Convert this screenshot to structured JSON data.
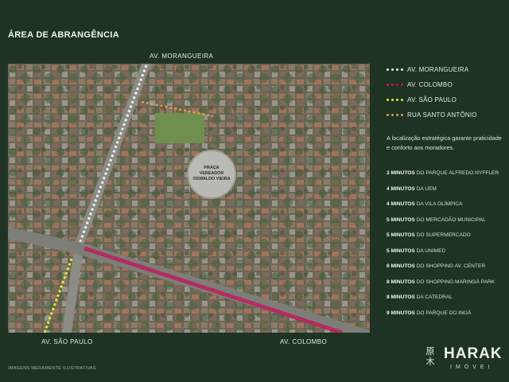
{
  "title": "ÁREA DE ABRANGÊNCIA",
  "map": {
    "road_labels": {
      "morangueira": "AV. MORANGUEIRA",
      "sao_paulo": "AV. SÃO PAULO",
      "colombo": "AV. COLOMBO"
    },
    "plaza_label": "PRAÇA VEREADOR OSWALDO VIEIRA"
  },
  "legend": [
    {
      "label": "AV. MORANGUEIRA",
      "color": "#e9ece8"
    },
    {
      "label": "AV. COLOMBO",
      "color": "#c2185b"
    },
    {
      "label": "AV. SÃO PAULO",
      "color": "#e3e838"
    },
    {
      "label": "RUA SANTO ANTÔNIO",
      "color": "#e39a4b"
    }
  ],
  "intro": "A localização estratégica garante praticidade e conforto aos moradores.",
  "distances": [
    {
      "time": "3 MINUTOS",
      "place": "DO PARQUE ALFREDO NYFFLER"
    },
    {
      "time": "4 MINUTOS",
      "place": "DA UEM"
    },
    {
      "time": "4 MINUTOS",
      "place": "DA VILA OLÍMPICA"
    },
    {
      "time": "5 MINUTOS",
      "place": "DO MERCADÃO MUNICIPAL"
    },
    {
      "time": "5 MINUTOS",
      "place": "DO SUPERMERCADO"
    },
    {
      "time": "5 MINUTOS",
      "place": "DA UNIMED"
    },
    {
      "time": "6 MINUTOS",
      "place": "DO SHOPPING AV. CENTER"
    },
    {
      "time": "8 MINUTOS",
      "place": "DO SHOPPING MARINGÁ PARK"
    },
    {
      "time": "8 MINUTOS",
      "place": "DA CATEDRAL"
    },
    {
      "time": "9 MINUTOS",
      "place": "DO PARQUE DO INGÁ"
    }
  ],
  "footnote": "IMAGENS MERAMENTE ILUSTRATIVAS",
  "brand": {
    "glyph": "原木",
    "name": "HARAK",
    "sub": "IMÓVEI"
  }
}
